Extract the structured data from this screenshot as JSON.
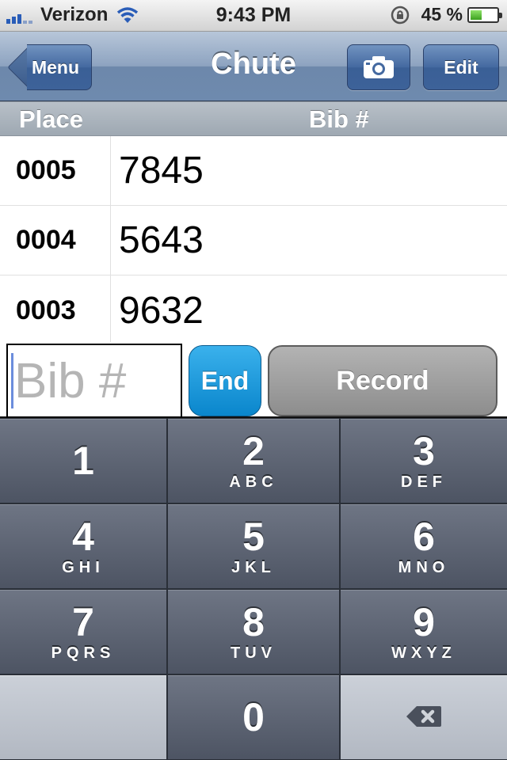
{
  "status_bar": {
    "carrier": "Verizon",
    "time": "9:43 PM",
    "battery_percent": "45 %",
    "battery_level": 0.45
  },
  "nav": {
    "title": "Chute",
    "back_label": "Menu",
    "camera_icon": "camera-icon",
    "edit_label": "Edit"
  },
  "columns": {
    "place": "Place",
    "bib": "Bib #"
  },
  "rows": [
    {
      "place": "0005",
      "bib": "7845"
    },
    {
      "place": "0004",
      "bib": "5643"
    },
    {
      "place": "0003",
      "bib": "9632"
    }
  ],
  "entry": {
    "placeholder": "Bib #",
    "value": "",
    "end_label": "End",
    "record_label": "Record"
  },
  "keypad": {
    "keys": [
      {
        "num": "1",
        "letters": ""
      },
      {
        "num": "2",
        "letters": "ABC"
      },
      {
        "num": "3",
        "letters": "DEF"
      },
      {
        "num": "4",
        "letters": "GHI"
      },
      {
        "num": "5",
        "letters": "JKL"
      },
      {
        "num": "6",
        "letters": "MNO"
      },
      {
        "num": "7",
        "letters": "PQRS"
      },
      {
        "num": "8",
        "letters": "TUV"
      },
      {
        "num": "9",
        "letters": "WXYZ"
      },
      {
        "num": "0",
        "letters": ""
      }
    ],
    "delete_icon": "backspace-icon"
  },
  "colors": {
    "nav_accent": "#6e8aae",
    "end_button": "#1a96dc",
    "record_button": "#9e9e9e",
    "keypad_key": "#5b6272"
  }
}
